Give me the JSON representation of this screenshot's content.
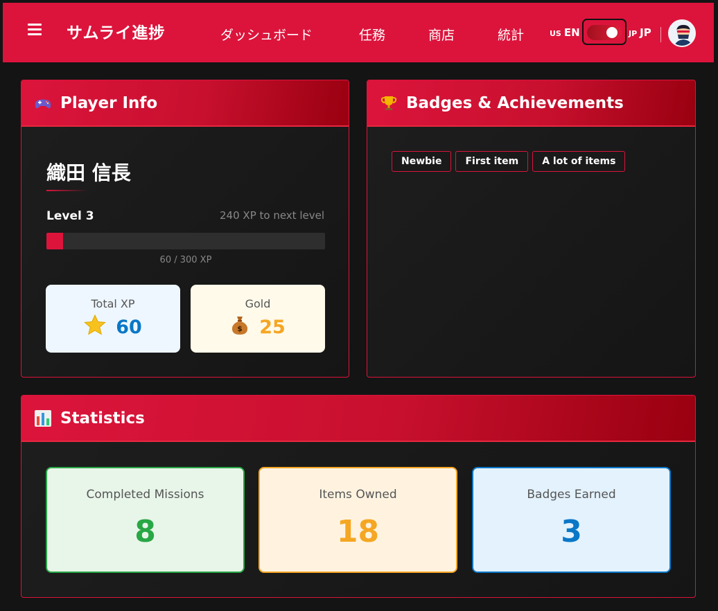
{
  "nav": {
    "brand": "サムライ進捗",
    "links": [
      "ダッシュボード",
      "任務",
      "商店",
      "統計"
    ],
    "lang_left_flag": "US",
    "lang_left": "EN",
    "lang_right_flag": "JP",
    "lang_right": "JP"
  },
  "player": {
    "header": "Player Info",
    "name": "織田 信長",
    "level": "Level 3",
    "xp_next": "240 XP to next level",
    "xp_progress": 0.2,
    "xp_count": "60 / 300 XP",
    "total_xp_label": "Total XP",
    "total_xp": "60",
    "gold_label": "Gold",
    "gold": "25"
  },
  "badges": {
    "header": "Badges & Achievements",
    "items": [
      "Newbie",
      "First item",
      "A lot of items"
    ]
  },
  "statistics": {
    "header": "Statistics",
    "completed_label": "Completed Missions",
    "completed": "8",
    "items_label": "Items Owned",
    "items": "18",
    "badges_label": "Badges Earned",
    "badges": "3"
  },
  "colors": {
    "accent": "#dc143c",
    "green": "#28a745",
    "orange": "#f5a623",
    "blue": "#0a77c7"
  }
}
